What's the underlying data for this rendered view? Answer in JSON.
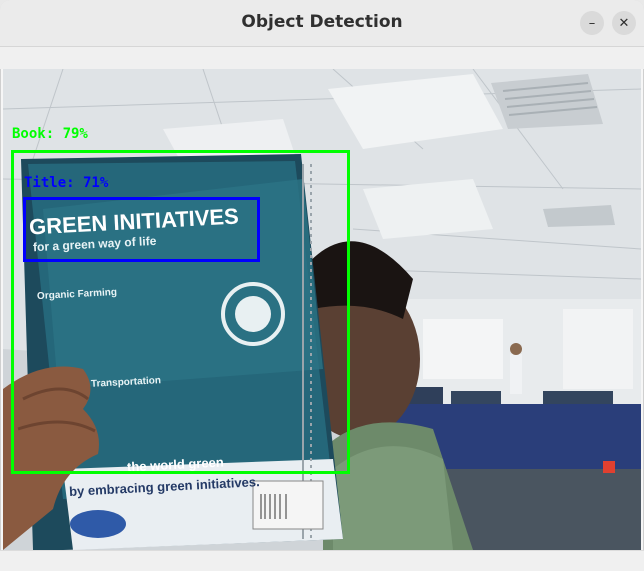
{
  "window": {
    "title": "Object Detection",
    "minimize_glyph": "–",
    "close_glyph": "✕"
  },
  "detections": [
    {
      "label": "Book: 79%",
      "color": "#00ff00"
    },
    {
      "label": "Title: 71%",
      "color": "#0000ff"
    }
  ],
  "book_cover": {
    "heading": "GREEN INITIATIVES",
    "subheading": "for a green way of life",
    "section1": "Organic Farming",
    "section2": "Transportation",
    "footer_line1": "the world green",
    "footer_line2": "by embracing green initiatives."
  }
}
